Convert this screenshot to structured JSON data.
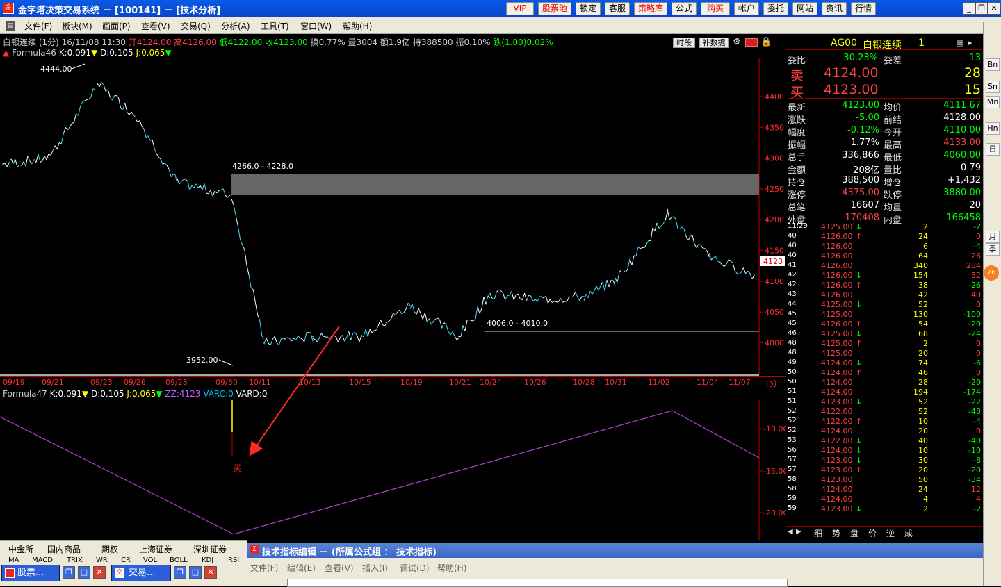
{
  "window": {
    "title": "金字塔决策交易系统 － [100141] － [技术分析]",
    "app_icon": "pyramid-icon",
    "top_buttons": [
      "VIP",
      "股票池",
      "锁定",
      "客服",
      "策略库",
      "公式",
      "购买",
      "帐户",
      "委托",
      "网站",
      "资讯",
      "行情"
    ],
    "top_buttons_red": [
      "VIP",
      "股票池",
      "策略库",
      "购买"
    ],
    "win_controls": [
      "_",
      "❐",
      "✕"
    ]
  },
  "menu": [
    "文件(F)",
    "板块(M)",
    "画面(P)",
    "查看(V)",
    "交易(Q)",
    "分析(A)",
    "工具(T)",
    "窗口(W)",
    "帮助(H)"
  ],
  "quote_line": {
    "name": "白银连续 (1分) 16/11/08 11:30",
    "open": "开4124.00",
    "high": "高4126.00",
    "low": "低4122.00",
    "close": "收4123.00",
    "turnover": "换0.77%",
    "volume": "量3004",
    "amount": "额1.9亿",
    "position": "持388500",
    "amplitude": "振0.10%",
    "change": "跌(1.00)0.02%"
  },
  "tool_buttons": [
    "时段",
    "补数据"
  ],
  "formula1": {
    "name": "Formula46",
    "k": "K:0.091",
    "d": "D:0.105",
    "j": "J:0.065"
  },
  "formula2": {
    "name": "Formula47",
    "k": "K:0.091",
    "d": "D:0.105",
    "j": "J:0.065",
    "zz": "ZZ:4123",
    "varc": "VARC:0",
    "vard": "VARD:0"
  },
  "main_chart": {
    "y_ticks": [
      "4400",
      "4350",
      "4300",
      "4250",
      "4200",
      "4150",
      "4100",
      "4050",
      "4000"
    ],
    "x_ticks": [
      "09/19",
      "09/21",
      "09/23",
      "09/26",
      "09/28",
      "09/30",
      "10/11",
      "10/13",
      "10/15",
      "10/19",
      "10/21",
      "10/24",
      "10/26",
      "10/28",
      "10/31",
      "11/02",
      "11/04",
      "11/07"
    ],
    "period_label": "1分",
    "annotations": {
      "peak": "4444.00",
      "trough": "3952.00",
      "zone": "4266.0 - 4228.0",
      "support": "4006.0 - 4010.0",
      "last_price": "4123"
    }
  },
  "sub_chart": {
    "y_ticks": [
      "-10.00",
      "-15.00",
      "-20.00"
    ],
    "buy_label": "买"
  },
  "chart_data": {
    "type": "line",
    "title": "",
    "ylabel": "",
    "xlabel": "",
    "ylim": [
      3940,
      4460
    ],
    "x": [
      "09/19",
      "09/21",
      "09/23",
      "09/26",
      "09/28",
      "09/30",
      "10/11",
      "10/13",
      "10/15",
      "10/19",
      "10/21",
      "10/24",
      "10/26",
      "10/28",
      "10/31",
      "11/02",
      "11/04",
      "11/07"
    ],
    "series": [
      {
        "name": "",
        "values": [
          4290,
          4300,
          4420,
          4370,
          4260,
          4240,
          4000,
          4010,
          4010,
          4060,
          4010,
          4080,
          4070,
          4075,
          4100,
          4210,
          4140,
          4110
        ]
      }
    ],
    "zones": [
      {
        "label": "4266.0 - 4228.0",
        "from": 4228.0,
        "to": 4266.0
      }
    ],
    "levels": [
      {
        "label": "4006.0 - 4010.0",
        "value": 4008.0
      }
    ]
  },
  "quote_panel": {
    "code": "AG00",
    "name": "白银连续",
    "count": "1",
    "webi_label": "委比",
    "webi": "-30.23%",
    "weicha_label": "委差",
    "weicha": "-13",
    "sell_label": "卖",
    "sell_price": "4124.00",
    "sell_vol": "28",
    "buy_label": "买",
    "buy_price": "4123.00",
    "buy_vol": "15",
    "rows": [
      {
        "l1": "最新",
        "v1": "4123.00",
        "c1": "dn",
        "l2": "均价",
        "v2": "4111.67",
        "c2": "dn"
      },
      {
        "l1": "涨跌",
        "v1": "-5.00",
        "c1": "dn",
        "l2": "前结",
        "v2": "4128.00",
        "c2": "wh"
      },
      {
        "l1": "幅度",
        "v1": "-0.12%",
        "c1": "dn",
        "l2": "今开",
        "v2": "4110.00",
        "c2": "dn"
      },
      {
        "l1": "振幅",
        "v1": "1.77%",
        "c1": "wh",
        "l2": "最高",
        "v2": "4133.00",
        "c2": "up"
      },
      {
        "l1": "总手",
        "v1": "336,866",
        "c1": "wh",
        "l2": "最低",
        "v2": "4060.00",
        "c2": "dn"
      },
      {
        "l1": "金额",
        "v1": "208亿",
        "c1": "wh",
        "l2": "量比",
        "v2": "0.79",
        "c2": "wh"
      },
      {
        "l1": "持仓",
        "v1": "388,500",
        "c1": "wh",
        "l2": "增仓",
        "v2": "+1,432",
        "c2": "wh"
      },
      {
        "l1": "涨停",
        "v1": "4375.00",
        "c1": "up",
        "l2": "跌停",
        "v2": "3880.00",
        "c2": "dn"
      },
      {
        "l1": "总笔",
        "v1": "16607",
        "c1": "wh",
        "l2": "均量",
        "v2": "20",
        "c2": "wh"
      },
      {
        "l1": "外盘",
        "v1": "170408",
        "c1": "up",
        "l2": "内盘",
        "v2": "166458",
        "c2": "dn"
      }
    ],
    "ticks": [
      {
        "t": "11:29",
        "p": "4125.00",
        "d": "↓",
        "v": "2",
        "c": "-2"
      },
      {
        "t": "40",
        "p": "4126.00",
        "d": "↑",
        "v": "24",
        "c": "0"
      },
      {
        "t": "40",
        "p": "4126.00",
        "d": "",
        "v": "6",
        "c": "-4"
      },
      {
        "t": "40",
        "p": "4126.00",
        "d": "",
        "v": "64",
        "c": "26"
      },
      {
        "t": "41",
        "p": "4126.00",
        "d": "",
        "v": "340",
        "c": "284"
      },
      {
        "t": "42",
        "p": "4126.00",
        "d": "↓",
        "v": "154",
        "c": "52"
      },
      {
        "t": "42",
        "p": "4126.00",
        "d": "↑",
        "v": "38",
        "c": "-26"
      },
      {
        "t": "43",
        "p": "4126.00",
        "d": "",
        "v": "42",
        "c": "40"
      },
      {
        "t": "44",
        "p": "4125.00",
        "d": "↓",
        "v": "52",
        "c": "0"
      },
      {
        "t": "45",
        "p": "4125.00",
        "d": "",
        "v": "130",
        "c": "-100"
      },
      {
        "t": "45",
        "p": "4126.00",
        "d": "↑",
        "v": "54",
        "c": "-20"
      },
      {
        "t": "46",
        "p": "4125.00",
        "d": "↓",
        "v": "68",
        "c": "-24"
      },
      {
        "t": "48",
        "p": "4125.00",
        "d": "↑",
        "v": "2",
        "c": "0"
      },
      {
        "t": "48",
        "p": "4125.00",
        "d": "",
        "v": "20",
        "c": "0"
      },
      {
        "t": "49",
        "p": "4124.00",
        "d": "↓",
        "v": "74",
        "c": "-6"
      },
      {
        "t": "50",
        "p": "4124.00",
        "d": "↑",
        "v": "46",
        "c": "0"
      },
      {
        "t": "50",
        "p": "4124.00",
        "d": "",
        "v": "28",
        "c": "-20"
      },
      {
        "t": "51",
        "p": "4124.00",
        "d": "",
        "v": "194",
        "c": "-174"
      },
      {
        "t": "51",
        "p": "4123.00",
        "d": "↓",
        "v": "52",
        "c": "-22"
      },
      {
        "t": "52",
        "p": "4122.00",
        "d": "",
        "v": "52",
        "c": "-48"
      },
      {
        "t": "52",
        "p": "4122.00",
        "d": "↑",
        "v": "10",
        "c": "-4"
      },
      {
        "t": "52",
        "p": "4124.00",
        "d": "",
        "v": "20",
        "c": "0"
      },
      {
        "t": "53",
        "p": "4122.00",
        "d": "↓",
        "v": "40",
        "c": "-40"
      },
      {
        "t": "56",
        "p": "4124.00",
        "d": "↓",
        "v": "10",
        "c": "-10"
      },
      {
        "t": "57",
        "p": "4123.00",
        "d": "↓",
        "v": "30",
        "c": "-8"
      },
      {
        "t": "57",
        "p": "4123.00",
        "d": "↑",
        "v": "20",
        "c": "-20"
      },
      {
        "t": "58",
        "p": "4123.00",
        "d": "",
        "v": "50",
        "c": "-34"
      },
      {
        "t": "58",
        "p": "4124.00",
        "d": "",
        "v": "24",
        "c": "12"
      },
      {
        "t": "59",
        "p": "4124.00",
        "d": "",
        "v": "4",
        "c": "4"
      },
      {
        "t": "59",
        "p": "4123.00",
        "d": "↓",
        "v": "2",
        "c": "-2"
      }
    ],
    "bottom_tabs": [
      "细",
      "势",
      "盘",
      "价",
      "逆",
      "成"
    ]
  },
  "side_buttons": [
    "Bn",
    "Sn",
    "Mn",
    "Hn",
    "日",
    "月",
    "季"
  ],
  "side_badge": "76",
  "market_tabs": [
    "中金所",
    "国内商品",
    "期权",
    "上海证券",
    "深圳证券"
  ],
  "indicator_tabs": [
    "MA",
    "MACD",
    "TRIX",
    "WR",
    "CR",
    "VOL",
    "BOLL",
    "KDJ",
    "RSI"
  ],
  "editor": {
    "title": "技术指标编辑 － (所属公式组 ： 技术指标)",
    "menus": [
      "文件(F)",
      "编辑(E)",
      "查看(V)",
      "插入(I)",
      "调试(D)",
      "帮助(H)"
    ]
  },
  "taskbar": [
    "股票...",
    "交易..."
  ]
}
